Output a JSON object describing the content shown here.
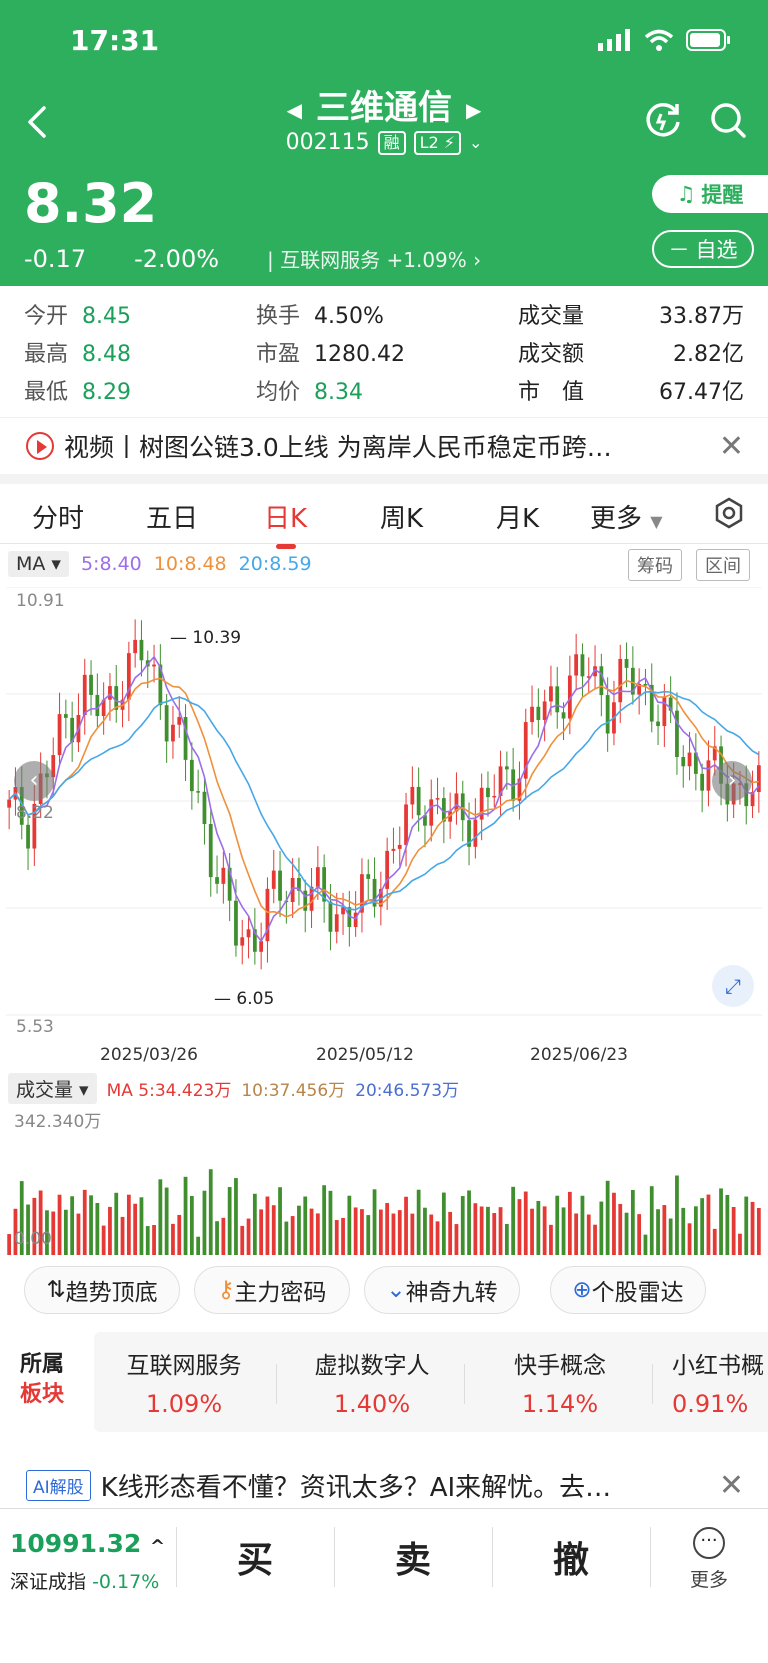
{
  "status": {
    "time": "17:31"
  },
  "header": {
    "stock_name": "三维通信",
    "code": "002115",
    "tag_margin": "融",
    "tag_l2": "L2",
    "price": "8.32",
    "change": "-0.17",
    "change_pct": "-2.00%",
    "sector": "互联网服务",
    "sector_change": "+1.09%",
    "remind_label": "提醒",
    "fav_label": "自选"
  },
  "quotes": {
    "open_label": "今开",
    "open": "8.45",
    "high_label": "最高",
    "high": "8.48",
    "low_label": "最低",
    "low": "8.29",
    "turnover_label": "换手",
    "turnover": "4.50%",
    "pe_label": "市盈",
    "pe": "1280.42",
    "avg_label": "均价",
    "avg": "8.34",
    "volume_label": "成交量",
    "volume": "33.87万",
    "amount_label": "成交额",
    "amount": "2.82亿",
    "mktcap_label": "市　值",
    "mktcap": "67.47亿"
  },
  "news": {
    "text": "视频丨树图公链3.0上线 为离岸人民币稳定币跨…"
  },
  "tabs": [
    "分时",
    "五日",
    "日K",
    "周K",
    "月K",
    "更多"
  ],
  "active_tab": "日K",
  "chart": {
    "ma_button": "MA",
    "ma5": "5:8.40",
    "ma10": "10:8.48",
    "ma20": "20:8.59",
    "chips_button": "筹码",
    "range_button": "区间",
    "y_top": "10.91",
    "y_mid": "8.22",
    "y_bottom": "5.53",
    "high_mark": "10.39",
    "low_mark": "6.05",
    "dates": [
      "2025/03/26",
      "2025/05/12",
      "2025/06/23"
    ],
    "vol_button": "成交量",
    "vol_ma5": "MA 5:34.423万",
    "vol_ma10": "10:37.456万",
    "vol_ma20": "20:46.573万",
    "vol_top": "342.340万",
    "vol_bottom": "0.00",
    "colors": {
      "up": "#e53935",
      "down": "#3f8f2f",
      "ma5": "#9c6ee8",
      "ma10": "#f0903a",
      "ma20": "#46a8e8"
    }
  },
  "chart_data": {
    "type": "candlestick",
    "title": "",
    "ylim": [
      5.53,
      10.91
    ],
    "x_ticks": [
      "2025/03/26",
      "2025/05/12",
      "2025/06/23"
    ],
    "annotations": [
      "10.39",
      "6.05"
    ],
    "series": [
      {
        "name": "MA5",
        "values": [
          "8.40"
        ]
      },
      {
        "name": "MA10",
        "values": [
          "8.48"
        ]
      },
      {
        "name": "MA20",
        "values": [
          "8.59"
        ]
      }
    ],
    "volume_range": [
      0,
      342.34
    ],
    "volume_ma": [
      "5:34.423万",
      "10:37.456万",
      "20:46.573万"
    ]
  },
  "indicators": [
    "趋势顶底",
    "主力密码",
    "神奇九转",
    "个股雷达"
  ],
  "sectors": {
    "title_line1": "所属",
    "title_line2": "板块",
    "items": [
      {
        "name": "互联网服务",
        "pct": "1.09%"
      },
      {
        "name": "虚拟数字人",
        "pct": "1.40%"
      },
      {
        "name": "快手概念",
        "pct": "1.14%"
      },
      {
        "name": "小红书概",
        "pct": "0.91%"
      }
    ]
  },
  "ai": {
    "tag": "AI解股",
    "text": "K线形态看不懂？资讯太多？AI来解忧。去…"
  },
  "bottom": {
    "index_value": "10991.32",
    "index_name": "深证成指",
    "index_pct": "-0.17%",
    "buy": "买",
    "sell": "卖",
    "cancel": "撤",
    "more": "更多"
  }
}
